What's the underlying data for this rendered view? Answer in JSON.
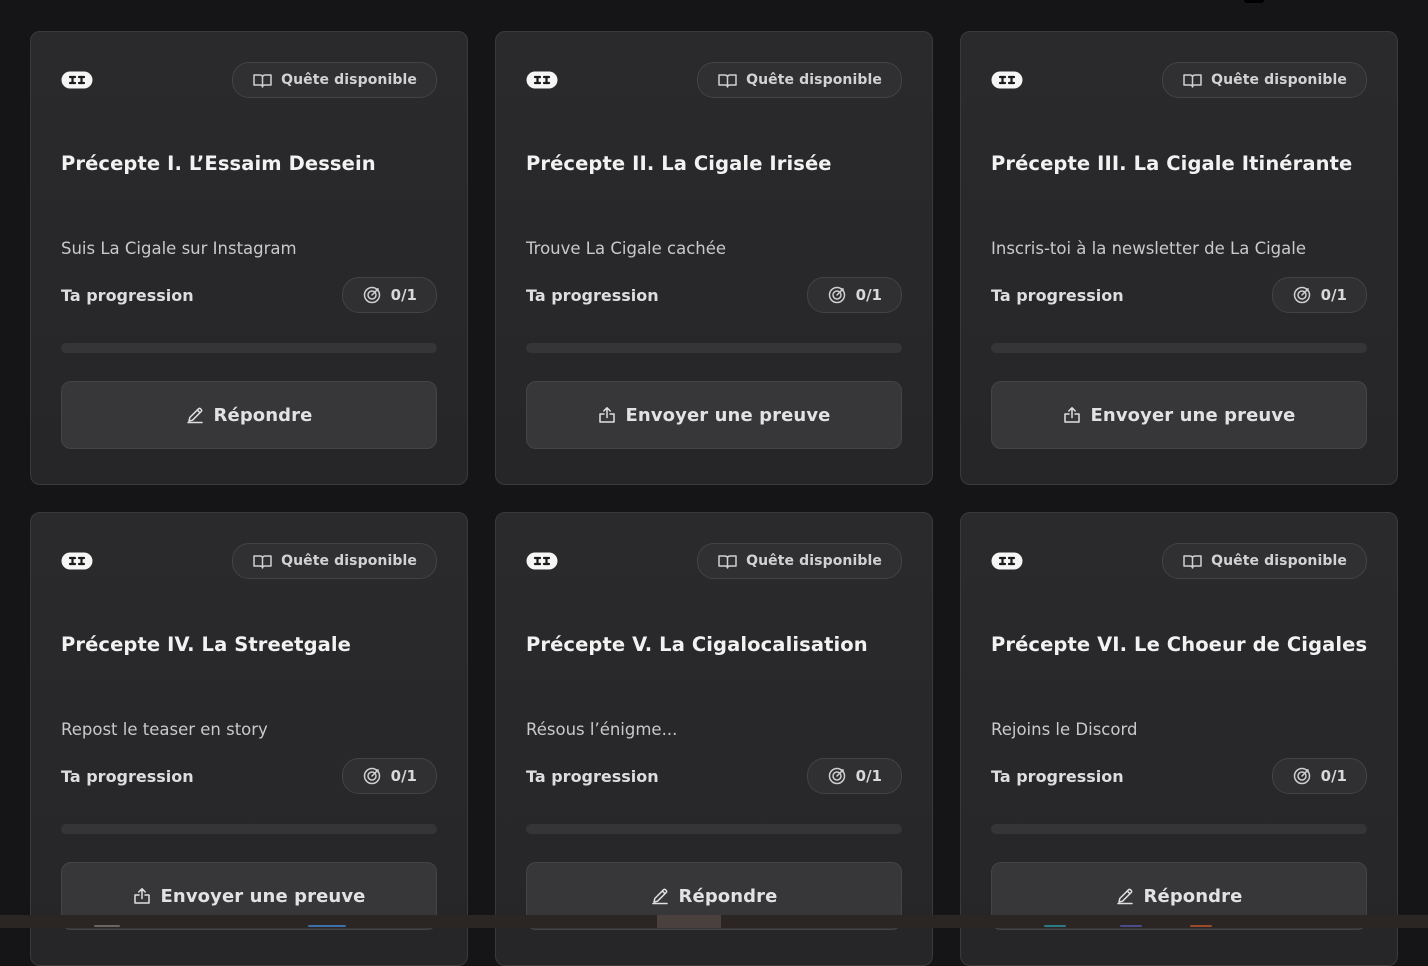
{
  "cards": [
    {
      "status": "Quête disponible",
      "title": "Précepte I. L’Essaim Dessein",
      "description": "Suis La Cigale sur Instagram",
      "progress_label": "Ta progression",
      "progress_count": "0/1",
      "progress_value": 0,
      "action_label": "Répondre",
      "action_icon": "pencil-icon"
    },
    {
      "status": "Quête disponible",
      "title": "Précepte II. La Cigale Irisée",
      "description": "Trouve La Cigale cachée",
      "progress_label": "Ta progression",
      "progress_count": "0/1",
      "progress_value": 0,
      "action_label": "Envoyer une preuve",
      "action_icon": "upload-icon"
    },
    {
      "status": "Quête disponible",
      "title": "Précepte III. La Cigale Itinérante",
      "description": "Inscris-toi à la newsletter de La Cigale",
      "progress_label": "Ta progression",
      "progress_count": "0/1",
      "progress_value": 0,
      "action_label": "Envoyer une preuve",
      "action_icon": "upload-icon"
    },
    {
      "status": "Quête disponible",
      "title": "Précepte IV. La Streetgale",
      "description": "Repost le teaser en story",
      "progress_label": "Ta progression",
      "progress_count": "0/1",
      "progress_value": 0,
      "action_label": "Envoyer une preuve",
      "action_icon": "upload-icon"
    },
    {
      "status": "Quête disponible",
      "title": "Précepte V. La Cigalocalisation",
      "description": "Résous l’énigme...",
      "progress_label": "Ta progression",
      "progress_count": "0/1",
      "progress_value": 0,
      "action_label": "Répondre",
      "action_icon": "pencil-icon"
    },
    {
      "status": "Quête disponible",
      "title": "Précepte VI. Le Choeur de Cigales",
      "description": "Rejoins le Discord",
      "progress_label": "Ta progression",
      "progress_count": "0/1",
      "progress_value": 0,
      "action_label": "Répondre",
      "action_icon": "pencil-icon"
    }
  ],
  "icons": {
    "card_badge": "ticket-icon",
    "status": "book-open-icon",
    "progress": "target-icon"
  },
  "colors": {
    "background": "#151517",
    "card": "#2a2a2c",
    "button": "#373739",
    "text": "#f2f2f2"
  }
}
